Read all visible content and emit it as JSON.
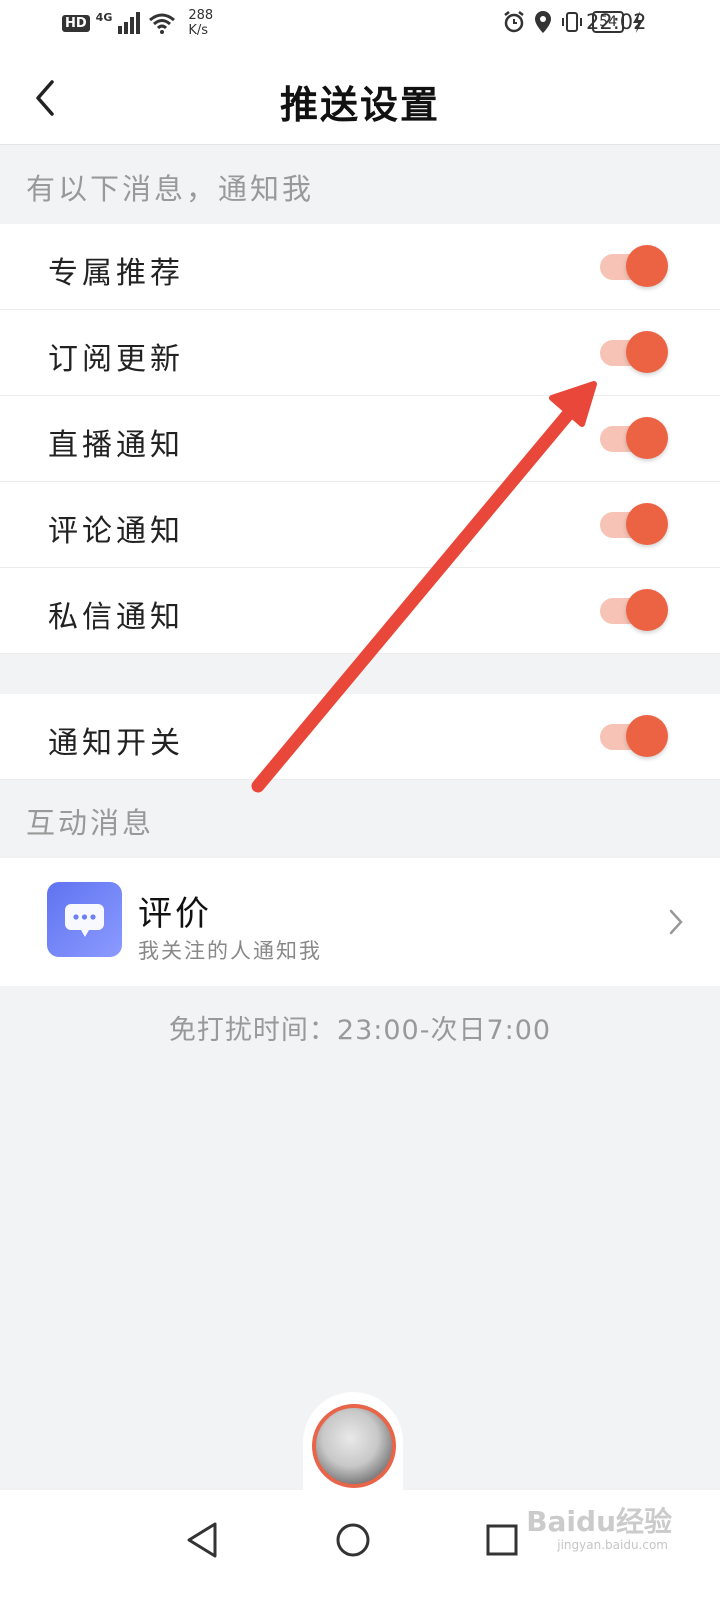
{
  "status_bar": {
    "hd": "HD",
    "network": "4G",
    "speed_value": "288",
    "speed_unit": "K/s",
    "battery": "54",
    "time": "22:02",
    "icons": [
      "alarm-icon",
      "location-icon",
      "vibrate-icon",
      "battery-icon",
      "charging-icon"
    ]
  },
  "header": {
    "title": "推送设置",
    "back_icon": "chevron-left-icon"
  },
  "notify_section": {
    "label": "有以下消息，通知我",
    "items": [
      {
        "label": "专属推荐",
        "enabled": true
      },
      {
        "label": "订阅更新",
        "enabled": true
      },
      {
        "label": "直播通知",
        "enabled": true
      },
      {
        "label": "评论通知",
        "enabled": true
      },
      {
        "label": "私信通知",
        "enabled": true
      }
    ]
  },
  "master_switch": {
    "label": "通知开关",
    "enabled": true
  },
  "interaction_section": {
    "label": "互动消息",
    "review": {
      "title": "评价",
      "subtitle": "我关注的人通知我",
      "icon": "chat-bubble-icon"
    }
  },
  "dnd_text": "免打扰时间：23:00-次日7:00",
  "nav_bar": {
    "buttons": [
      "back-triangle-icon",
      "home-circle-icon",
      "recents-square-icon"
    ]
  },
  "watermark": {
    "text": "Baidu经验",
    "sub": "jingyan.baidu.com"
  },
  "colors": {
    "toggle_on": "#ec6344",
    "toggle_track": "#f6c3b6",
    "annotation_arrow": "#e8473a",
    "review_icon": "#6f80f5"
  }
}
